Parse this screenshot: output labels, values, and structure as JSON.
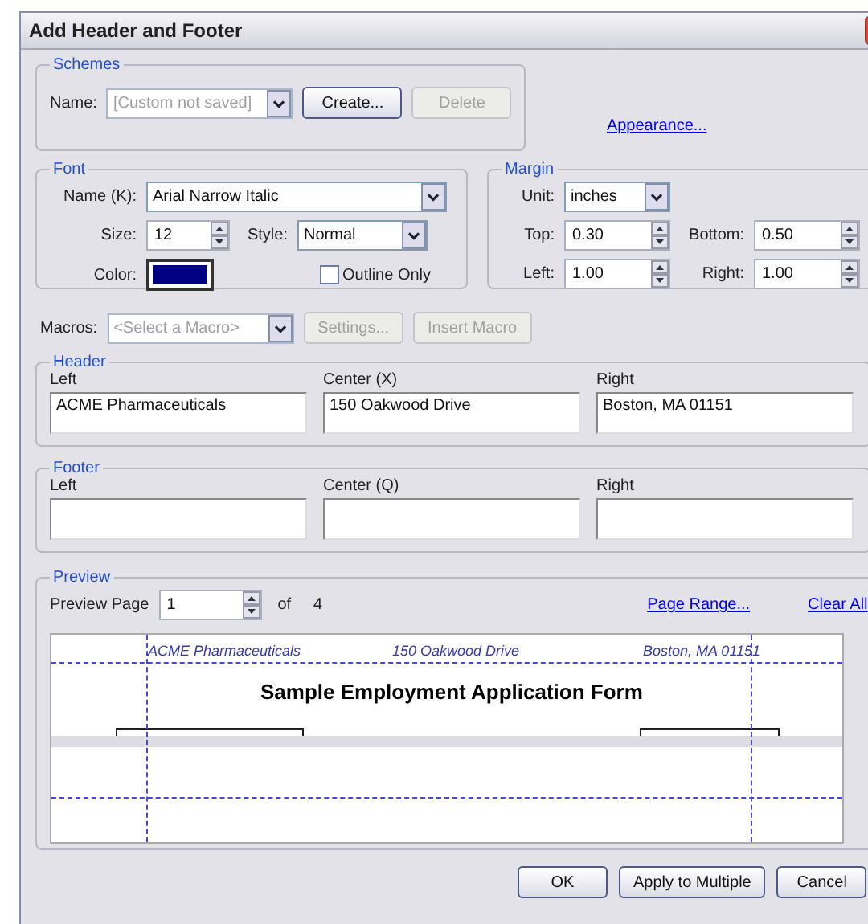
{
  "window": {
    "title": "Add Header and Footer"
  },
  "schemes": {
    "legend": "Schemes",
    "name_label": "Name:",
    "name_value": "[Custom not saved]",
    "name_disabled": true,
    "buttons": [
      {
        "label": "Create...",
        "disabled": false
      },
      {
        "label": "Delete",
        "disabled": true
      }
    ]
  },
  "appearance_link": "Appearance...",
  "font": {
    "legend": "Font",
    "name_label": "Name (K):",
    "name_value": "Arial Narrow Italic",
    "size_label": "Size:",
    "size_value": "12",
    "style_label": "Style:",
    "style_value": "Normal",
    "color_label": "Color:",
    "color": "#000080",
    "outline": {
      "label": "Outline Only",
      "checked": false
    }
  },
  "margin": {
    "legend": "Margin",
    "unit_label": "Unit:",
    "unit_value": "inches",
    "fields": [
      {
        "label": "Top:",
        "value": "0.30"
      },
      {
        "label": "Bottom:",
        "value": "0.50"
      },
      {
        "label": "Left:",
        "value": "1.00"
      },
      {
        "label": "Right:",
        "value": "1.00"
      }
    ]
  },
  "macros": {
    "label": "Macros:",
    "value": "<Select a Macro>",
    "disabled": true,
    "buttons": [
      {
        "label": "Settings...",
        "disabled": true
      },
      {
        "label": "Insert Macro",
        "disabled": true
      }
    ]
  },
  "header": {
    "legend": "Header",
    "fields": [
      {
        "label": "Left",
        "value": "ACME Pharmaceuticals"
      },
      {
        "label": "Center (X)",
        "value": "150 Oakwood Drive"
      },
      {
        "label": "Right",
        "value": "Boston, MA 01151"
      }
    ]
  },
  "footer": {
    "legend": "Footer",
    "fields": [
      {
        "label": "Left"
      },
      {
        "label": "Center (Q)"
      },
      {
        "label": "Right"
      }
    ]
  },
  "preview": {
    "legend": "Preview",
    "page_label": "Preview Page",
    "page_value": "1",
    "of_label": "of",
    "page_count": "4",
    "links": [
      "Page Range...",
      "Clear All"
    ],
    "header_texts": [
      "ACME Pharmaceuticals",
      "150 Oakwood Drive",
      "Boston, MA 01151"
    ],
    "document_title": "Sample Employment Application Form"
  },
  "buttons": [
    "OK",
    "Apply to Multiple",
    "Cancel"
  ]
}
